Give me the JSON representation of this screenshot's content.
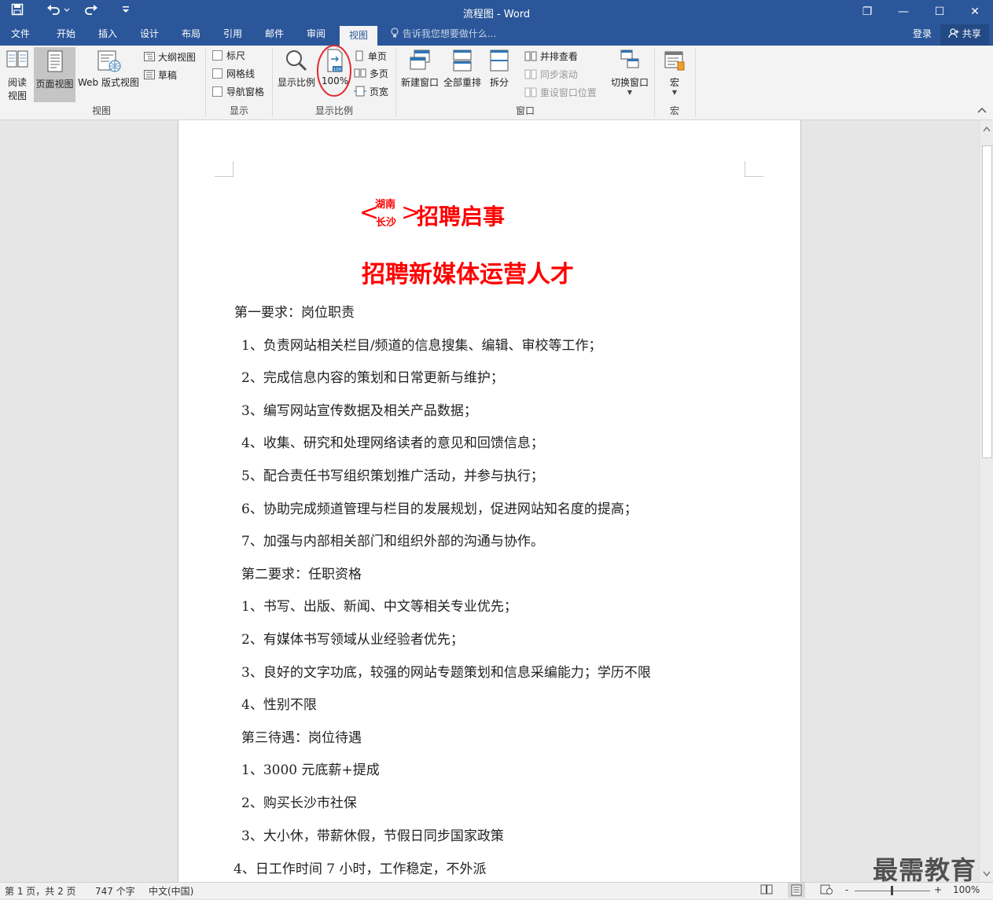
{
  "window": {
    "title": "流程图 - Word",
    "controls": {
      "restore": "❐",
      "minimize": "—",
      "maximize": "☐",
      "close": "✕"
    },
    "quick_access": {
      "save": "save-icon",
      "undo": "undo-icon",
      "redo": "redo-icon",
      "customize": "customize-icon"
    }
  },
  "tabs": [
    "文件",
    "开始",
    "插入",
    "设计",
    "布局",
    "引用",
    "邮件",
    "审阅",
    "视图"
  ],
  "active_tab": "视图",
  "tell_me": "告诉我您想要做什么...",
  "account": {
    "signin": "登录",
    "share": "共享"
  },
  "ribbon": {
    "views": {
      "label": "视图",
      "read_mode_line1": "阅读",
      "read_mode_line2": "视图",
      "print_layout": "页面视图",
      "web_layout": "Web 版式视图",
      "outline": "大纲视图",
      "draft": "草稿"
    },
    "show": {
      "label": "显示",
      "ruler": "标尺",
      "gridlines": "网格线",
      "nav_pane": "导航窗格"
    },
    "zoom": {
      "label": "显示比例",
      "zoom": "显示比例",
      "hundred": "100%",
      "one_page": "单页",
      "multi_page": "多页",
      "page_width": "页宽"
    },
    "window": {
      "label": "窗口",
      "new_window": "新建窗口",
      "arrange_all": "全部重排",
      "split": "拆分",
      "side_by_side": "并排查看",
      "sync_scroll": "同步滚动",
      "reset_position": "重设窗口位置",
      "switch_windows": "切换窗口"
    },
    "macros": {
      "label": "宏",
      "macros": "宏"
    }
  },
  "document": {
    "header_small_top": "湖南",
    "header_small_bottom": "长沙",
    "header_open": "<",
    "header_close": ">",
    "title": "招聘启事",
    "subtitle": "招聘新媒体运营人才",
    "lines": [
      "第一要求：岗位职责",
      "1、负责网站相关栏目/频道的信息搜集、编辑、审校等工作；",
      "2、完成信息内容的策划和日常更新与维护；",
      "3、编写网站宣传数据及相关产品数据；",
      "4、收集、研究和处理网络读者的意见和回馈信息；",
      "5、配合责任书写组织策划推广活动，并参与执行；",
      "6、协助完成频道管理与栏目的发展规划，促进网站知名度的提高；",
      "7、加强与内部相关部门和组织外部的沟通与协作。",
      "第二要求：任职资格",
      "1、书写、出版、新闻、中文等相关专业优先；",
      "2、有媒体书写领域从业经验者优先；",
      "3、良好的文字功底，较强的网站专题策划和信息采编能力；学历不限",
      "4、性别不限",
      "第三待遇：岗位待遇",
      "1、3000 元底薪+提成",
      "2、购买长沙市社保",
      "3、大小休，带薪休假，节假日同步国家政策",
      "4、日工作时间 7 小时，工作稳定，不外派"
    ]
  },
  "status": {
    "page": "第 1 页，共 2 页",
    "words": "747 个字",
    "language": "中文(中国)",
    "zoom_minus": "-",
    "zoom_plus": "+",
    "zoom": "100%"
  },
  "watermark": "最需教育",
  "colors": {
    "brand": "#2b579a",
    "title_red": "#ff0000",
    "highlight_circle": "#e0282e"
  }
}
